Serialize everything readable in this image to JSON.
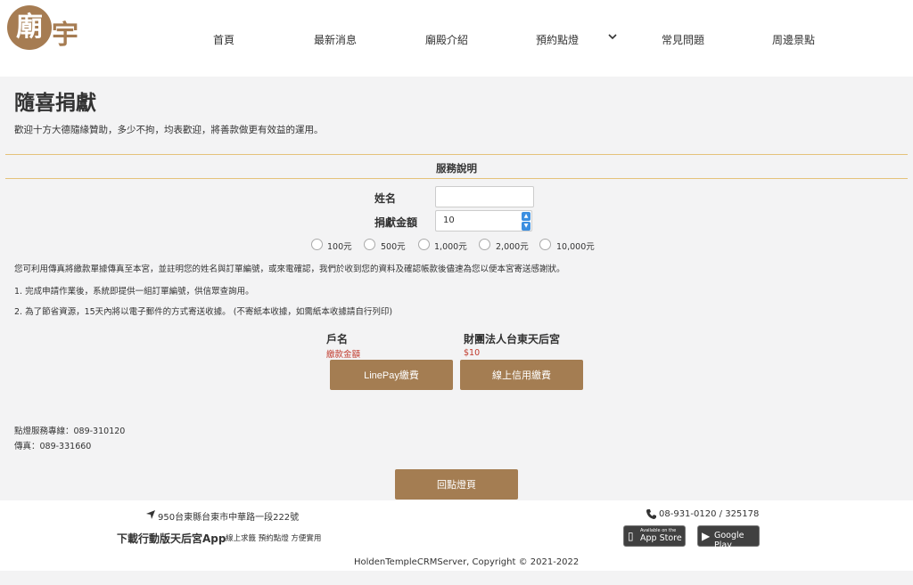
{
  "header": {
    "logo_text": "廟宇",
    "nav": [
      "首頁",
      "最新消息",
      "廟殿介紹",
      "預約點燈",
      "常見問題",
      "周邊景點"
    ]
  },
  "main": {
    "title": "隨喜捐獻",
    "intro": "歡迎十方大德隨緣贊助，多少不拘，均表歡迎，將善款做更有效益的運用。",
    "section_title": "服務說明",
    "form": {
      "name_label": "姓名",
      "name_value": "",
      "amount_label": "捐獻金額",
      "amount_value": "10",
      "amount_options": [
        "100元",
        "500元",
        "1,000元",
        "2,000元",
        "10,000元"
      ]
    },
    "notes": [
      "您可利用傳真將繳款單據傳真至本宮，並註明您的姓名與訂單編號，或來電確認，我們於收到您的資料及確認帳款後儘速為您以便本宮寄送感謝狀。",
      "1. 完成申請作業後，系統即提供一組訂單編號，供信眾查詢用。",
      "2. 為了節省資源，15天內將以電子郵件的方式寄送收據。 (不寄紙本收據，如需紙本收據請自行列印)"
    ],
    "account": {
      "label": "戶名",
      "name": "財團法人台東天后宮",
      "due_label": "繳款金額",
      "due_value": "$10"
    },
    "buttons": {
      "linepay": "LinePay繳費",
      "credit": "線上信用繳費",
      "back": "回點燈頁"
    },
    "contact": {
      "hotline": "點燈服務專線：089-310120",
      "fax": "傳真：089-331660"
    }
  },
  "footer": {
    "address": "950台東縣台東市中華路一段222號",
    "phone": "08-931-0120 / 325178",
    "app_title": "下載行動版天后宮App",
    "app_sub": "線上求籤 預約點燈 方便實用",
    "appstore_small": "Available on the",
    "appstore_big": "App Store",
    "googleplay_big": "Google Play",
    "copyright": "HoldenTempleCRMServer, Copyright © 2021-2022"
  },
  "colors": {
    "accent": "#a47d52",
    "rule": "#e4c27a",
    "alert": "#c0392b",
    "spinner": "#3c8fe0"
  }
}
